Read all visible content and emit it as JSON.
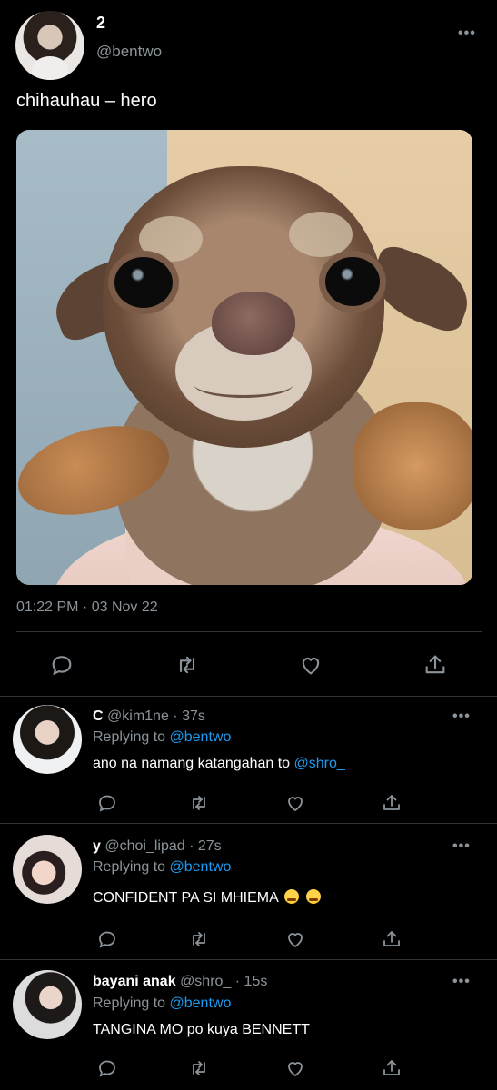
{
  "tweet": {
    "display_name": "2",
    "handle": "@bentwo",
    "text": "chihauhau – hero",
    "timestamp": "01:22 PM · 03 Nov 22",
    "more_label": "•••"
  },
  "replies": [
    {
      "name": "C",
      "handle": "@kim1ne",
      "time": "· 37s",
      "replying_label": "Replying to",
      "replying_to": "@bentwo",
      "text": "ano na namang katangahan to",
      "mention": "@shro_",
      "more_label": "•••"
    },
    {
      "name": "y",
      "handle": "@choi_lipad",
      "time": "· 27s",
      "replying_label": "Replying to",
      "replying_to": "@bentwo",
      "text": "CONFIDENT PA SI MHIEMA",
      "more_label": "•••"
    },
    {
      "name": "bayani anak",
      "handle": "@shro_",
      "time": "· 15s",
      "replying_label": "Replying to",
      "replying_to": "@bentwo",
      "text": "TANGINA MO po kuya BENNETT",
      "more_label": "•••"
    }
  ],
  "icons": [
    "reply-icon",
    "retweet-icon",
    "like-icon",
    "share-icon",
    "more-icon"
  ],
  "colors": {
    "background": "#000000",
    "link": "#1d9bf0",
    "muted": "#8b949a",
    "divider": "#2f3336"
  }
}
